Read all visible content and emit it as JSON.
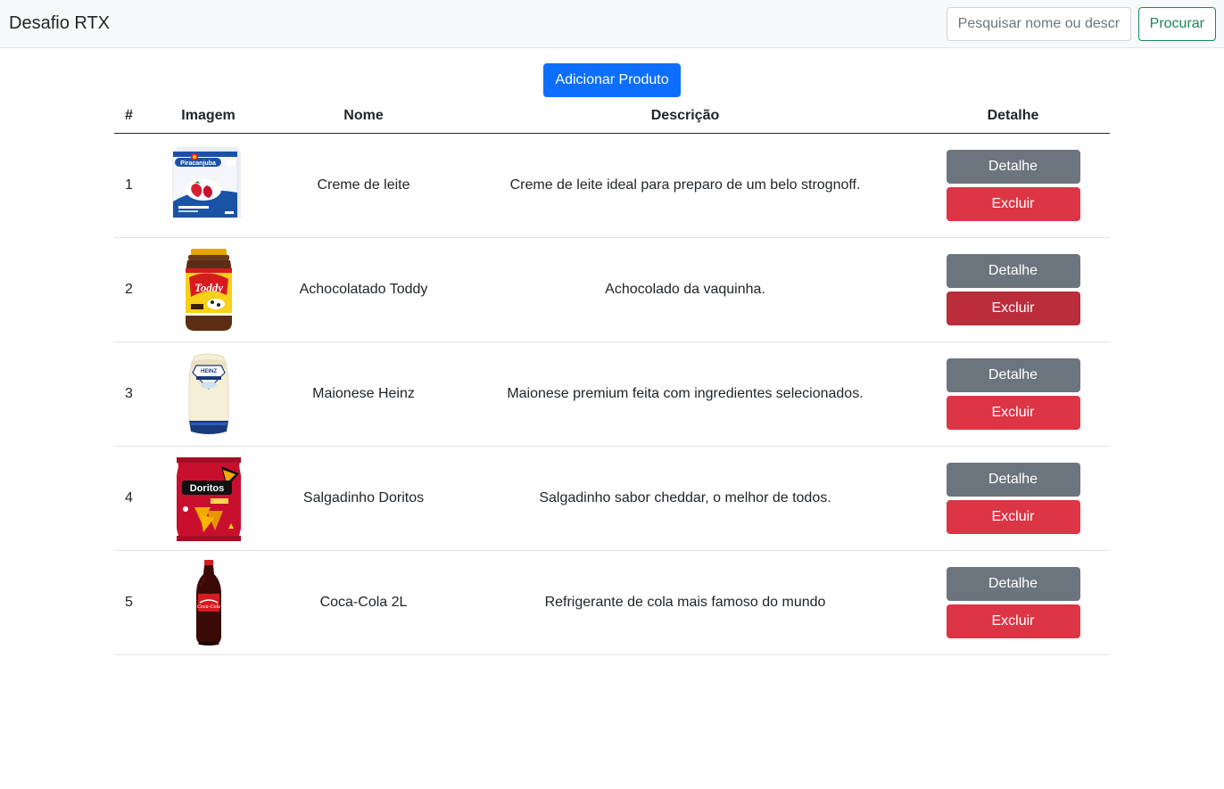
{
  "navbar": {
    "brand": "Desafio RTX",
    "search_placeholder": "Pesquisar nome ou descrição",
    "search_button": "Procurar"
  },
  "actions": {
    "add_button": "Adicionar Produto"
  },
  "table": {
    "headers": [
      "#",
      "Imagem",
      "Nome",
      "Descrição",
      "Detalhe"
    ],
    "rows": [
      {
        "id": "1",
        "image_icon": "creme-de-leite-carton-icon",
        "nome": "Creme de leite",
        "descricao": "Creme de leite ideal para preparo de um belo strognoff.",
        "detail_label": "Detalhe",
        "delete_label": "Excluir"
      },
      {
        "id": "2",
        "image_icon": "toddy-jar-icon",
        "nome": "Achocolatado Toddy",
        "descricao": "Achocolado da vaquinha.",
        "detail_label": "Detalhe",
        "delete_label": "Excluir"
      },
      {
        "id": "3",
        "image_icon": "mayonnaise-bottle-icon",
        "nome": "Maionese Heinz",
        "descricao": "Maionese premium feita com ingredientes selecionados.",
        "detail_label": "Detalhe",
        "delete_label": "Excluir"
      },
      {
        "id": "4",
        "image_icon": "chips-bag-icon",
        "nome": "Salgadinho Doritos",
        "descricao": "Salgadinho sabor cheddar, o melhor de todos.",
        "detail_label": "Detalhe",
        "delete_label": "Excluir"
      },
      {
        "id": "5",
        "image_icon": "soda-bottle-icon",
        "nome": "Coca-Cola 2L",
        "descricao": "Refrigerante de cola mais famoso do mundo",
        "detail_label": "Detalhe",
        "delete_label": "Excluir"
      }
    ]
  },
  "product_logos": {
    "piracanjuba": "Piracanjuba",
    "toddy": "Toddy",
    "heinz": "HEINZ",
    "doritos": "Doritos",
    "coca": "Coca-Cola"
  },
  "colors": {
    "primary": "#0d6efd",
    "secondary": "#6c757d",
    "danger": "#dc3545",
    "danger_hover": "#bb2d3b",
    "success": "#198754"
  }
}
